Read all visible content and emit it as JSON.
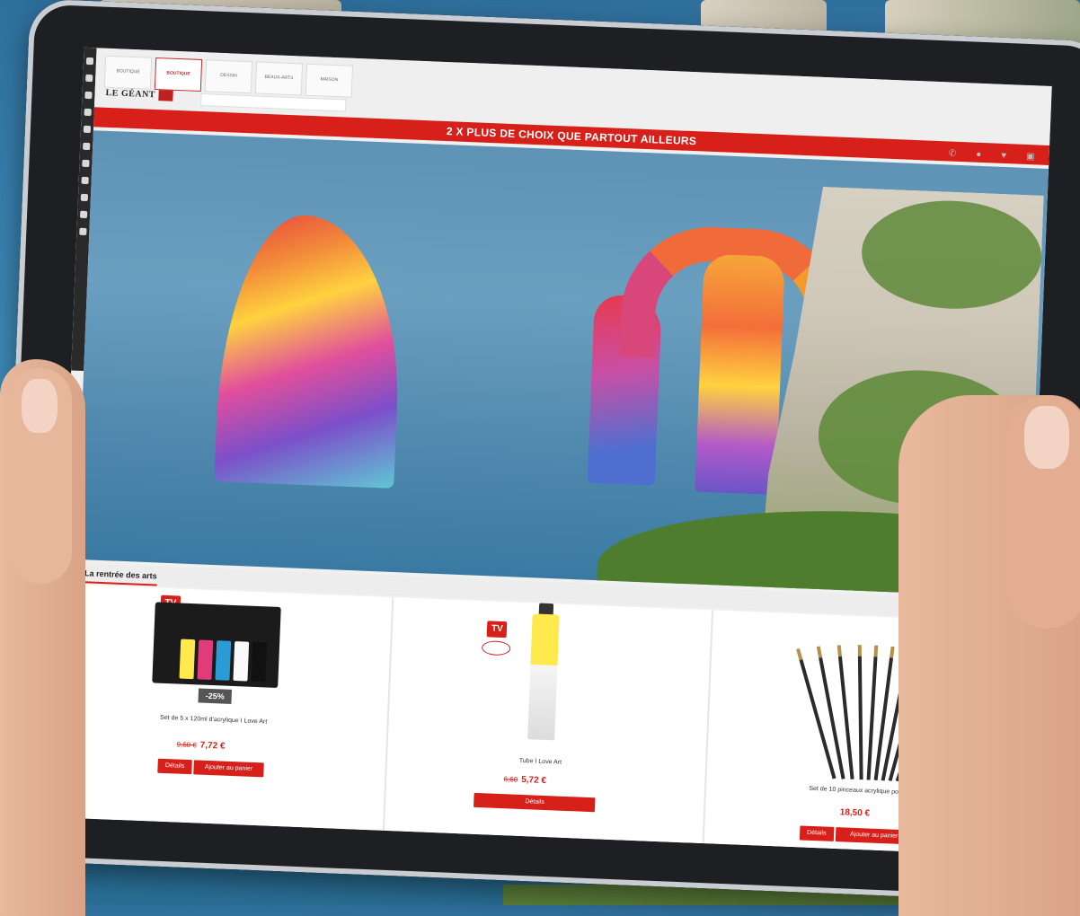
{
  "header": {
    "shop_tabs": [
      "BOUTIQUE",
      "BOUTIQUE",
      "DESSIN",
      "BEAUX-ARTS",
      "MAISON"
    ],
    "logo": "LE GÉANT",
    "search_placeholder": ""
  },
  "banner": "2 X PLUS DE CHOIX QUE PARTOUT AILLEURS",
  "section_tabs": [
    "La rentrée des arts",
    "",
    ""
  ],
  "products": [
    {
      "badge": "TV",
      "discount": "-25%",
      "name": "Set de 5 x 120ml d'acrylique I Love Art",
      "old_price": "9,60 €",
      "price": "7,72 €",
      "btn_details": "Détails",
      "btn_cart": "Ajouter au panier"
    },
    {
      "badge": "TV",
      "name": "Tube I Love Art",
      "old_price": "6,60",
      "price": "5,72 €",
      "btn_details": "Détails"
    },
    {
      "name": "Set de 10 pinceaux acrylique pointe ronde",
      "price": "18,50 €",
      "btn_details": "Détails",
      "btn_cart": "Ajouter au panier"
    }
  ],
  "colors": {
    "brand_red": "#d8201a"
  }
}
